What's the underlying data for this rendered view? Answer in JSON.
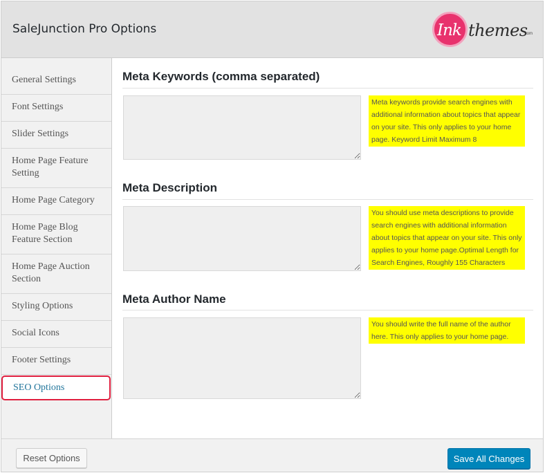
{
  "header": {
    "title": "SaleJunction Pro Options",
    "logo": {
      "mark": "Ink",
      "word": "themes",
      "suffix": ".com"
    }
  },
  "sidebar": {
    "items": [
      {
        "label": "General Settings"
      },
      {
        "label": "Font Settings"
      },
      {
        "label": "Slider Settings"
      },
      {
        "label": "Home Page Feature Setting"
      },
      {
        "label": "Home Page Category"
      },
      {
        "label": "Home Page Blog Feature Section"
      },
      {
        "label": "Home Page Auction Section"
      },
      {
        "label": "Styling Options"
      },
      {
        "label": "Social Icons"
      },
      {
        "label": "Footer Settings"
      },
      {
        "label": "SEO Options",
        "active": true
      }
    ]
  },
  "sections": [
    {
      "title": "Meta Keywords (comma separated)",
      "value": "",
      "hint": "Meta keywords provide search engines with additional information about topics that appear on your site. This only applies to your home page. Keyword Limit Maximum 8"
    },
    {
      "title": "Meta Description",
      "value": "",
      "hint": "You should use meta descriptions to provide search engines with additional information about topics that appear on your site. This only applies to your home page.Optimal Length for Search Engines, Roughly 155 Characters"
    },
    {
      "title": "Meta Author Name",
      "value": "",
      "hint": "You should write the full name of the author here. This only applies to your home page."
    }
  ],
  "footer": {
    "reset_label": "Reset Options",
    "save_label": "Save All Changes"
  },
  "colors": {
    "accent": "#0085ba",
    "hint_bg": "#ffff00",
    "active_outline": "#e01f3f",
    "logo_pink": "#e8326d"
  }
}
